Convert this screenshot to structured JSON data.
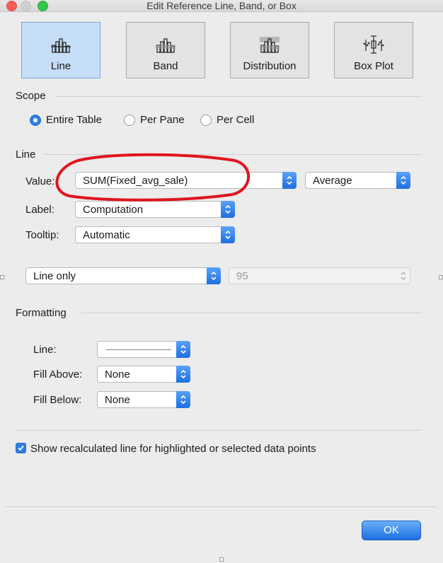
{
  "window": {
    "title": "Edit Reference Line, Band, or Box"
  },
  "type_tabs": [
    {
      "label": "Line",
      "icon": "line-chart-icon",
      "selected": true
    },
    {
      "label": "Band",
      "icon": "band-chart-icon",
      "selected": false
    },
    {
      "label": "Distribution",
      "icon": "distribution-chart-icon",
      "selected": false
    },
    {
      "label": "Box Plot",
      "icon": "box-plot-icon",
      "selected": false
    }
  ],
  "scope": {
    "heading": "Scope",
    "options": [
      {
        "label": "Entire Table",
        "selected": true
      },
      {
        "label": "Per Pane",
        "selected": false
      },
      {
        "label": "Per Cell",
        "selected": false
      }
    ]
  },
  "line": {
    "heading": "Line",
    "value_label": "Value:",
    "value": "SUM(Fixed_avg_sale)",
    "aggregation": "Average",
    "label_label": "Label:",
    "label_value": "Computation",
    "tooltip_label": "Tooltip:",
    "tooltip_value": "Automatic",
    "display": "Line only",
    "confidence": "95"
  },
  "formatting": {
    "heading": "Formatting",
    "line_label": "Line:",
    "fill_above_label": "Fill Above:",
    "fill_above_value": "None",
    "fill_below_label": "Fill Below:",
    "fill_below_value": "None"
  },
  "recalc": {
    "label": "Show recalculated line for highlighted or selected data points",
    "checked": true
  },
  "ok_label": "OK",
  "colors": {
    "accent": "#2f7de1",
    "selected_tab": "#c7def9",
    "annotation": "#e0141e"
  }
}
